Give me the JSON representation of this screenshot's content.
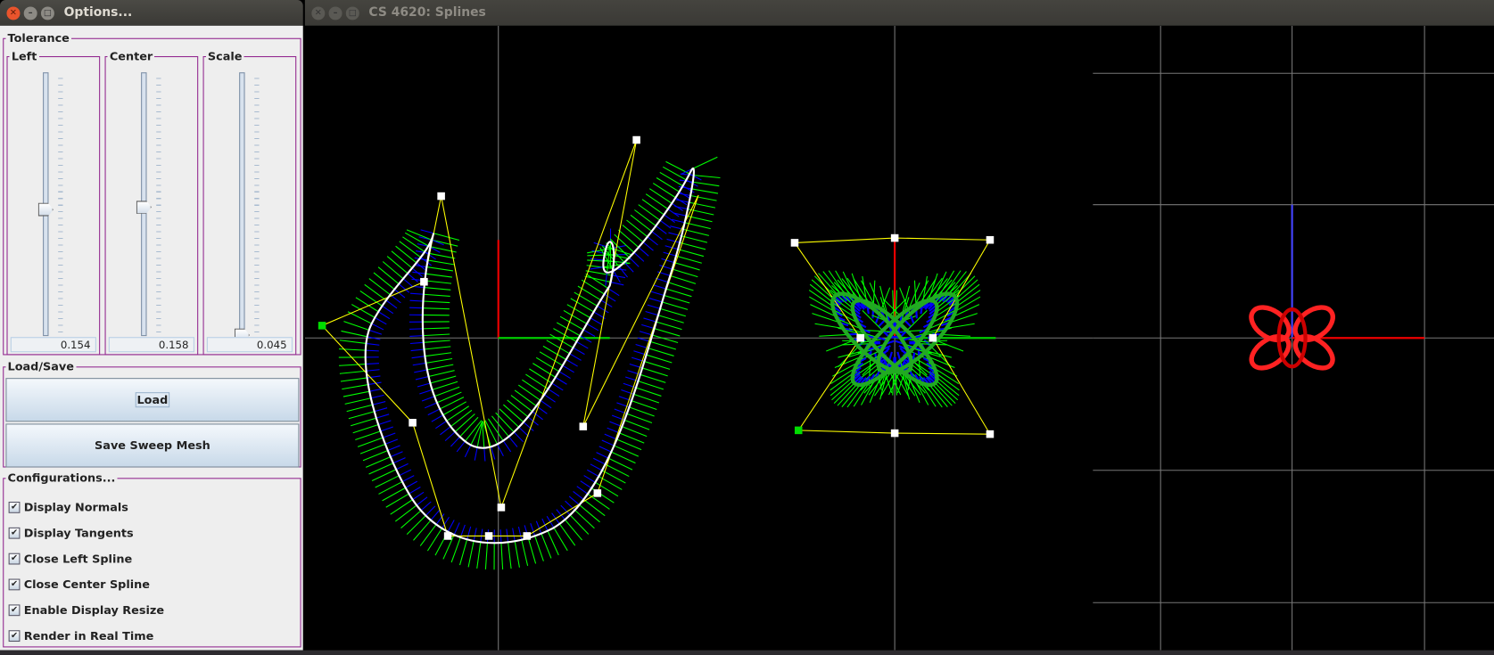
{
  "options_window": {
    "title": "Options...",
    "tolerance": {
      "label": "Tolerance",
      "sliders": [
        {
          "label": "Left",
          "value": "0.154",
          "thumb_fraction": 0.49
        },
        {
          "label": "Center",
          "value": "0.158",
          "thumb_fraction": 0.5
        },
        {
          "label": "Scale",
          "value": "0.045",
          "thumb_fraction": 0.0
        }
      ]
    },
    "load_save": {
      "label": "Load/Save",
      "load": "Load",
      "save": "Save Sweep Mesh"
    },
    "configurations": {
      "label": "Configurations...",
      "items": [
        {
          "label": "Display Normals",
          "checked": true
        },
        {
          "label": "Display Tangents",
          "checked": true
        },
        {
          "label": "Close Left Spline",
          "checked": true
        },
        {
          "label": "Close Center Spline",
          "checked": true
        },
        {
          "label": "Enable Display Resize",
          "checked": true
        },
        {
          "label": "Render in Real Time",
          "checked": true
        }
      ]
    }
  },
  "main_window": {
    "title": "CS 4620: Splines"
  },
  "colors": {
    "border": "#92278f",
    "curve": "#ffffff",
    "tangent": "#00ff00",
    "normal": "#0000ff",
    "control": "#ffff00",
    "mesh": "#ff0000"
  }
}
